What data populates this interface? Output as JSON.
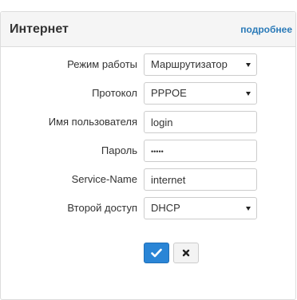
{
  "panel": {
    "title": "Интернет",
    "details_link": "подробнее"
  },
  "form": {
    "mode": {
      "label": "Режим работы",
      "value": "Маршрутизатор"
    },
    "protocol": {
      "label": "Протокол",
      "value": "PPPOE"
    },
    "username": {
      "label": "Имя пользователя",
      "value": "login"
    },
    "password": {
      "label": "Пароль",
      "value": "•••••"
    },
    "service_name": {
      "label": "Service-Name",
      "value": "internet"
    },
    "secondary_access": {
      "label": "Второй доступ",
      "value": "DHCP"
    }
  },
  "buttons": {
    "apply_icon": "checkmark-icon",
    "cancel_icon": "close-icon"
  },
  "colors": {
    "accent": "#2a85d6",
    "link": "#2a7ab8"
  }
}
